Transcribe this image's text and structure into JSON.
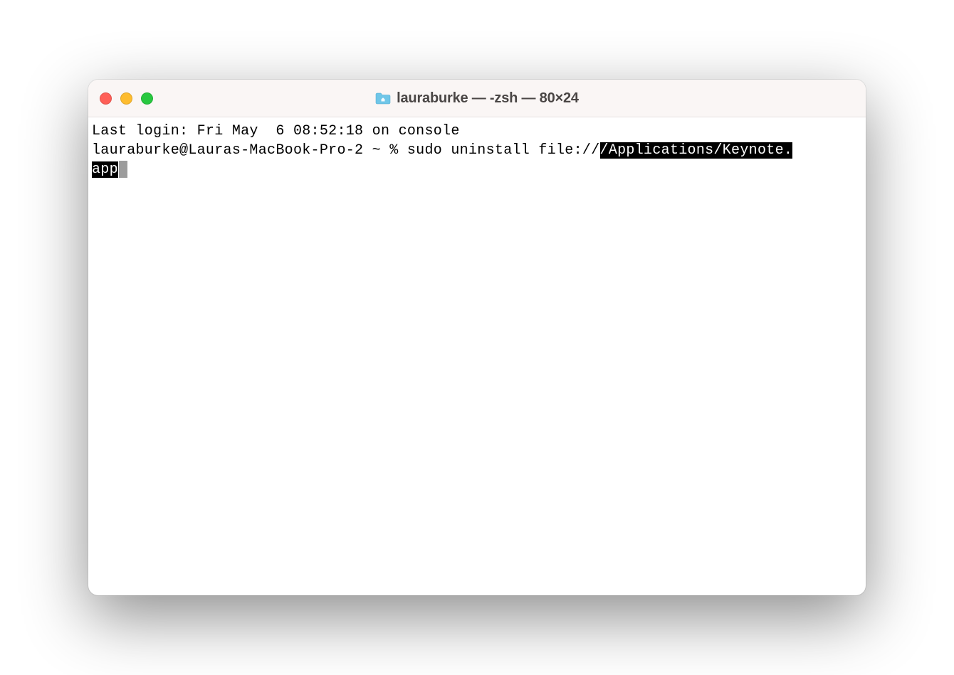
{
  "window": {
    "title": "lauraburke — -zsh — 80×24",
    "traffic_lights": {
      "close_color": "#ff5f57",
      "minimize_color": "#febc2e",
      "zoom_color": "#28c840"
    }
  },
  "terminal": {
    "last_login_line": "Last login: Fri May  6 08:52:18 on console",
    "prompt": "lauraburke@Lauras-MacBook-Pro-2 ~ % ",
    "command_plain": "sudo uninstall file://",
    "command_highlight_part1": "/Applications/Keynote.",
    "command_highlight_part2": "app"
  }
}
